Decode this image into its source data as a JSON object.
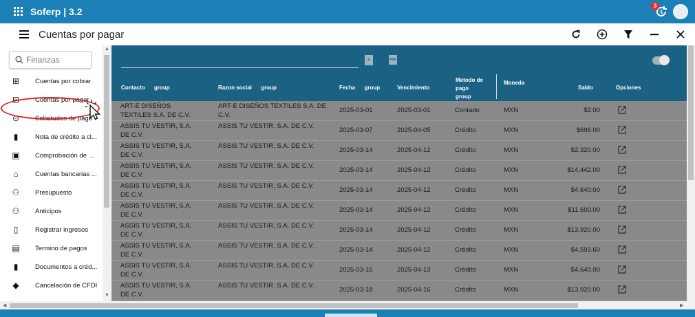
{
  "app": {
    "title": "Soferp | 3.2",
    "notification_count": "3"
  },
  "page": {
    "title": "Cuentas por pagar"
  },
  "sidebar": {
    "search_placeholder": "Finanzas",
    "items": [
      {
        "label": "Cuentas por cobrar",
        "icon": "money-in-icon"
      },
      {
        "label": "Cuentas por pagar",
        "icon": "money-out-icon"
      },
      {
        "label": "Solicitudes de pago",
        "icon": "payment-request-icon"
      },
      {
        "label": "Nota de crédito a cl...",
        "icon": "document-icon"
      },
      {
        "label": "Comprobación de ...",
        "icon": "receipt-icon"
      },
      {
        "label": "Cuentas bancarias ...",
        "icon": "bank-icon"
      },
      {
        "label": "Presupuesto",
        "icon": "budget-icon"
      },
      {
        "label": "Anticipos",
        "icon": "advance-icon"
      },
      {
        "label": "Registrar ingresos",
        "icon": "register-income-icon"
      },
      {
        "label": "Termino de pagos",
        "icon": "payment-terms-icon"
      },
      {
        "label": "Documentos a créd...",
        "icon": "document-icon"
      },
      {
        "label": "Cancelación de CFDI",
        "icon": "cancel-cfdi-icon"
      }
    ]
  },
  "table": {
    "headers": {
      "contacto": "Contacto",
      "contacto_group": "group",
      "razon": "Razon social",
      "razon_group": "group",
      "fecha": "Fecha",
      "fecha_group": "group",
      "vencimiento": "Vencimiento",
      "metodo_1": "Metodo de",
      "metodo_2": "pago",
      "metodo_3": "group",
      "moneda": "Moneda",
      "saldo": "Saldo",
      "opciones": "Opciones"
    },
    "rows": [
      {
        "contacto": "ART-E DISEÑOS TEXTILES S.A. DE C.V.",
        "razon": "ART-E DISEÑOS TEXTILES S.A. DE C.V.",
        "fecha": "2025-03-01",
        "vencimiento": "2025-03-01",
        "metodo": "Contado",
        "moneda": "MXN",
        "saldo": "$2.00"
      },
      {
        "contacto": "ASSIS TU VESTIR, S.A. DE C.V.",
        "razon": "ASSIS TU VESTIR, S.A. DE C.V.",
        "fecha": "2025-03-07",
        "vencimiento": "2025-04-05",
        "metodo": "Crédito",
        "moneda": "MXN",
        "saldo": "$696.00"
      },
      {
        "contacto": "ASSIS TU VESTIR, S.A. DE C.V.",
        "razon": "ASSIS TU VESTIR, S.A. DE C.V.",
        "fecha": "2025-03-14",
        "vencimiento": "2025-04-12",
        "metodo": "Crédito",
        "moneda": "MXN",
        "saldo": "$2,320.00"
      },
      {
        "contacto": "ASSIS TU VESTIR, S.A. DE C.V.",
        "razon": "ASSIS TU VESTIR, S.A. DE C.V.",
        "fecha": "2025-03-14",
        "vencimiento": "2025-04-12",
        "metodo": "Crédito",
        "moneda": "MXN",
        "saldo": "$14,442.00"
      },
      {
        "contacto": "ASSIS TU VESTIR, S.A. DE C.V.",
        "razon": "ASSIS TU VESTIR, S.A. DE C.V.",
        "fecha": "2025-03-14",
        "vencimiento": "2025-04-12",
        "metodo": "Crédito",
        "moneda": "MXN",
        "saldo": "$4,640.00"
      },
      {
        "contacto": "ASSIS TU VESTIR, S.A. DE C.V.",
        "razon": "ASSIS TU VESTIR, S.A. DE C.V.",
        "fecha": "2025-03-14",
        "vencimiento": "2025-04-12",
        "metodo": "Crédito",
        "moneda": "MXN",
        "saldo": "$11,600.00"
      },
      {
        "contacto": "ASSIS TU VESTIR, S.A. DE C.V.",
        "razon": "ASSIS TU VESTIR, S.A. DE C.V.",
        "fecha": "2025-03-14",
        "vencimiento": "2025-04-12",
        "metodo": "Crédito",
        "moneda": "MXN",
        "saldo": "$13,920.00"
      },
      {
        "contacto": "ASSIS TU VESTIR, S.A. DE C.V.",
        "razon": "ASSIS TU VESTIR, S.A. DE C.V.",
        "fecha": "2025-03-14",
        "vencimiento": "2025-04-12",
        "metodo": "Crédito",
        "moneda": "MXN",
        "saldo": "$4,593.60"
      },
      {
        "contacto": "ASSIS TU VESTIR, S.A. DE C.V.",
        "razon": "ASSIS TU VESTIR, S.A. DE C.V.",
        "fecha": "2025-03-15",
        "vencimiento": "2025-04-13",
        "metodo": "Crédito",
        "moneda": "MXN",
        "saldo": "$4,640.00"
      },
      {
        "contacto": "ASSIS TU VESTIR, S.A. DE C.V.",
        "razon": "ASSIS TU VESTIR, S.A. DE C.V.",
        "fecha": "2025-03-18",
        "vencimiento": "2025-04-16",
        "metodo": "Crédito",
        "moneda": "MXN",
        "saldo": "$13,920.00"
      }
    ]
  },
  "colors": {
    "brand": "#1c7fb6",
    "table_header": "#1a6184",
    "overlay": "#898989",
    "highlight": "#d9252b"
  }
}
